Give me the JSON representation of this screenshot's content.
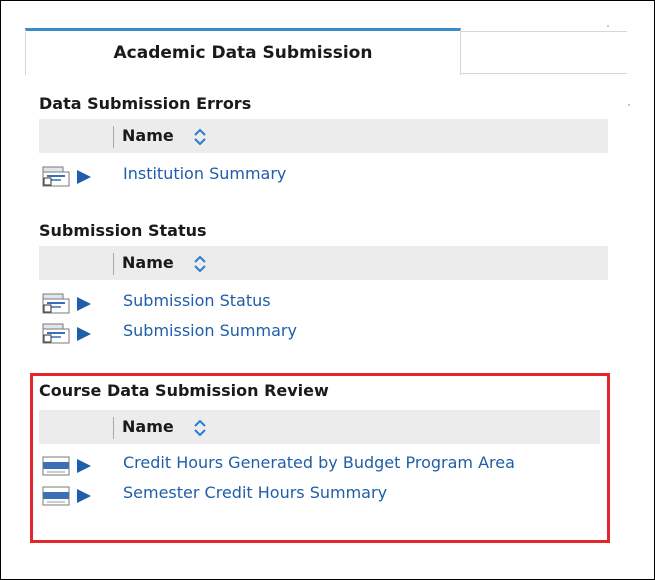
{
  "tab": {
    "label": "Academic Data Submission"
  },
  "column_header_label": "Name",
  "sections": [
    {
      "title": "Data Submission Errors",
      "items": [
        {
          "label": "Institution Summary",
          "icon": "report-icon"
        }
      ]
    },
    {
      "title": "Submission Status",
      "items": [
        {
          "label": "Submission Status",
          "icon": "report-icon"
        },
        {
          "label": "Submission Summary",
          "icon": "report-icon"
        }
      ]
    },
    {
      "title": "Course Data Submission Review",
      "items": [
        {
          "label": "Credit Hours Generated by Budget Program Area",
          "icon": "html-report-icon"
        },
        {
          "label": "Semester Credit Hours Summary",
          "icon": "html-report-icon"
        }
      ]
    }
  ],
  "colors": {
    "link": "#1f5ea8",
    "tab_accent": "#3a8cc9",
    "highlight_border": "#e3262b",
    "header_bg": "#ececec"
  }
}
